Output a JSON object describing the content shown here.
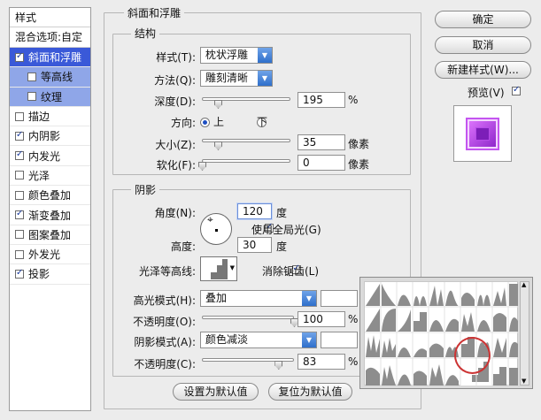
{
  "left_panel": {
    "header": "样式",
    "blend_options": "混合选项:自定",
    "items": [
      {
        "label": "斜面和浮雕",
        "checked": true,
        "state": "selected"
      },
      {
        "label": "等高线",
        "checked": false,
        "state": "sub"
      },
      {
        "label": "纹理",
        "checked": false,
        "state": "sub"
      },
      {
        "label": "描边",
        "checked": false,
        "state": ""
      },
      {
        "label": "内阴影",
        "checked": true,
        "state": ""
      },
      {
        "label": "内发光",
        "checked": true,
        "state": ""
      },
      {
        "label": "光泽",
        "checked": false,
        "state": ""
      },
      {
        "label": "颜色叠加",
        "checked": false,
        "state": ""
      },
      {
        "label": "渐变叠加",
        "checked": true,
        "state": ""
      },
      {
        "label": "图案叠加",
        "checked": false,
        "state": ""
      },
      {
        "label": "外发光",
        "checked": false,
        "state": ""
      },
      {
        "label": "投影",
        "checked": true,
        "state": ""
      }
    ]
  },
  "bevel": {
    "title": "斜面和浮雕",
    "structure": {
      "title": "结构",
      "style_label": "样式(T):",
      "style_value": "枕状浮雕",
      "technique_label": "方法(Q):",
      "technique_value": "雕刻清晰",
      "depth_label": "深度(D):",
      "depth_value": "195",
      "depth_unit": "%",
      "depth_fraction": 0.18,
      "direction_label": "方向:",
      "direction_up": "上",
      "direction_down": "下",
      "direction_selected": "up",
      "size_label": "大小(Z):",
      "size_value": "35",
      "size_unit": "像素",
      "size_fraction": 0.18,
      "soften_label": "软化(F):",
      "soften_value": "0",
      "soften_unit": "像素",
      "soften_fraction": 0.0
    },
    "shading": {
      "title": "阴影",
      "angle_label": "角度(N):",
      "angle_value": "120",
      "angle_unit": "度",
      "global_light_label": "使用全局光(G)",
      "global_light_checked": true,
      "altitude_label": "高度:",
      "altitude_value": "30",
      "altitude_unit": "度",
      "gloss_contour_label": "光泽等高线:",
      "anti_alias_label": "消除锯齿(L)",
      "anti_alias_checked": true,
      "highlight_mode_label": "高光模式(H):",
      "highlight_mode_value": "叠加",
      "highlight_opacity_label": "不透明度(O):",
      "highlight_opacity_value": "100",
      "highlight_opacity_fraction": 1.0,
      "shadow_mode_label": "阴影模式(A):",
      "shadow_mode_value": "颜色减淡",
      "shadow_opacity_label": "不透明度(C):",
      "shadow_opacity_value": "83",
      "shadow_opacity_fraction": 0.83,
      "percent": "%"
    },
    "make_default": "设置为默认值",
    "reset_default": "复位为默认值"
  },
  "right": {
    "ok": "确定",
    "cancel": "取消",
    "new_style": "新建样式(W)...",
    "preview_label": "预览(V)",
    "preview_checked": true
  },
  "colors": {
    "selected_bg": "#3a59d8",
    "sub_bg": "#8fa6e8",
    "preview_purple": "#a531d9",
    "highlight_circle": "#cc3333"
  }
}
